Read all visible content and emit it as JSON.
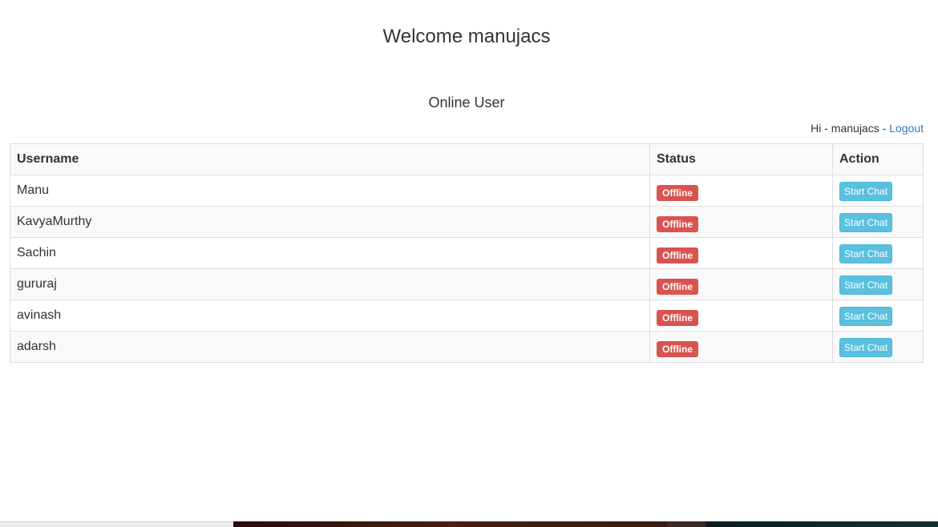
{
  "header": {
    "welcome": "Welcome manujacs",
    "section_title": "Online User"
  },
  "user_bar": {
    "prefix": "Hi - manujacs - ",
    "logout_label": "Logout"
  },
  "table": {
    "columns": [
      "Username",
      "Status",
      "Action"
    ],
    "rows": [
      {
        "username": "Manu",
        "status": "Offline",
        "action": "Start Chat"
      },
      {
        "username": "KavyaMurthy",
        "status": "Offline",
        "action": "Start Chat"
      },
      {
        "username": "Sachin",
        "status": "Offline",
        "action": "Start Chat"
      },
      {
        "username": "gururaj",
        "status": "Offline",
        "action": "Start Chat"
      },
      {
        "username": "avinash",
        "status": "Offline",
        "action": "Start Chat"
      },
      {
        "username": "adarsh",
        "status": "Offline",
        "action": "Start Chat"
      }
    ]
  },
  "colors": {
    "offline_badge": "#d9534f",
    "chat_button": "#5bc0de",
    "link": "#337ab7"
  }
}
